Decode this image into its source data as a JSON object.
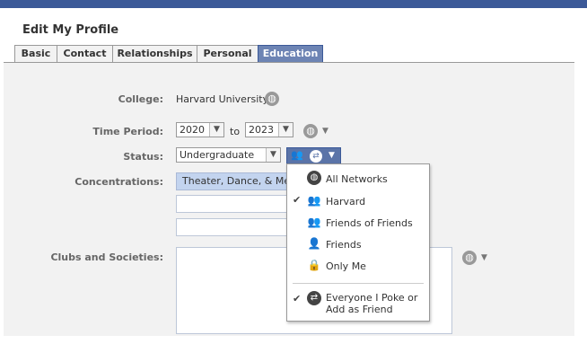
{
  "dialog": {
    "title": "Edit My Profile"
  },
  "tabs": [
    {
      "label": "Basic",
      "active": false
    },
    {
      "label": "Contact",
      "active": false
    },
    {
      "label": "Relationships",
      "active": false
    },
    {
      "label": "Personal",
      "active": false
    },
    {
      "label": "Education",
      "active": true
    }
  ],
  "form": {
    "college_label": "College:",
    "college_value": "Harvard University",
    "time_period_label": "Time Period:",
    "time_start": "2020",
    "time_to": "to",
    "time_end": "2023",
    "status_label": "Status:",
    "status_value": "Undergraduate",
    "concentrations_label": "Concentrations:",
    "concentration_1": "Theater, Dance, & Media",
    "concentration_2": "",
    "concentration_3": "",
    "clubs_label": "Clubs and Societies:",
    "clubs_value": ""
  },
  "privacy_menu": {
    "items": [
      {
        "label": "All Networks",
        "checked": false,
        "icon": "globe-icon"
      },
      {
        "label": "Harvard",
        "checked": true,
        "icon": "people-group-icon"
      },
      {
        "label": "Friends of Friends",
        "checked": false,
        "icon": "people-pair-icon"
      },
      {
        "label": "Friends",
        "checked": false,
        "icon": "person-icon"
      },
      {
        "label": "Only Me",
        "checked": false,
        "icon": "lock-icon"
      }
    ],
    "poke_line1": "Everyone I Poke or",
    "poke_line2": "Add as Friend",
    "poke_checked": true
  },
  "colors": {
    "brand_blue": "#3b5998",
    "active_tab": "#6d84b4",
    "panel_bg": "#f2f2f2",
    "highlight": "#c3d4ef"
  }
}
